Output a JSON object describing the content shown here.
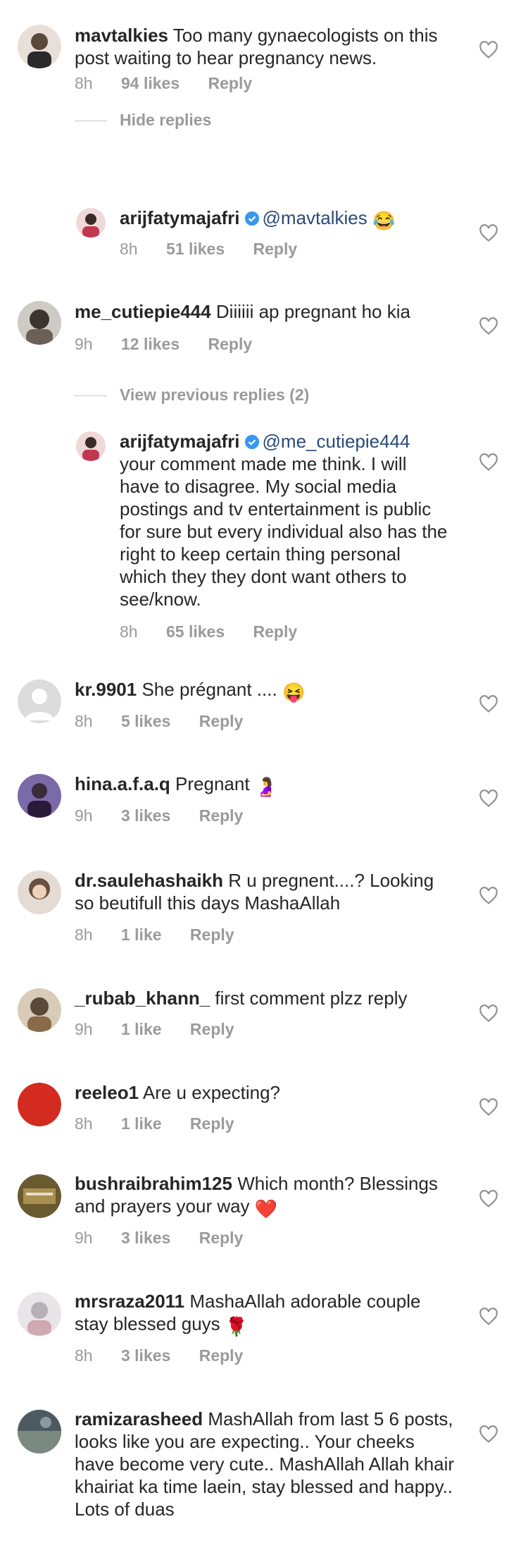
{
  "comments": [
    {
      "username": "mavtalkies",
      "text": "Too many gynaecologists on this post waiting to hear pregnancy news.",
      "time": "8h",
      "likes": "94 likes",
      "reply": "Reply",
      "avatar_color": "#5a4a3a",
      "toggle": "Hide replies",
      "replies": [
        {
          "username": "arijfatymajafri",
          "mention": "@mavtalkies",
          "text": "",
          "emoji": "😂",
          "time": "8h",
          "likes": "51 likes",
          "reply": "Reply",
          "avatar_color": "#c0384e"
        }
      ]
    },
    {
      "username": "me_cutiepie444",
      "text": "Diiiiii ap pregnant ho kia",
      "time": "9h",
      "likes": "12 likes",
      "reply": "Reply",
      "avatar_color": "#3b3530",
      "toggle": "View previous replies (2)",
      "replies": [
        {
          "username": "arijfatymajafri",
          "mention": "@me_cutiepie444",
          "text": "your comment made me think. I will have to disagree. My social media postings and tv entertainment is public for sure but every individual also has the right to keep certain thing personal which they they dont want others to see/know.",
          "time": "8h",
          "likes": "65 likes",
          "reply": "Reply",
          "avatar_color": "#c0384e"
        }
      ]
    },
    {
      "username": "kr.9901",
      "text": "She prégnant ....",
      "emoji": "😝",
      "time": "8h",
      "likes": "5 likes",
      "reply": "Reply",
      "avatar_color": "#dcdcdc"
    },
    {
      "username": "hina.a.f.a.q",
      "text": "Pregnant",
      "emoji": "🤰",
      "time": "9h",
      "likes": "3 likes",
      "reply": "Reply",
      "avatar_color": "#4a3a6a"
    },
    {
      "username": "dr.saulehashaikh",
      "text": "R u pregnent....? Looking so beutifull this days MashaAllah",
      "time": "8h",
      "likes": "1 like",
      "reply": "Reply",
      "avatar_color": "#6a5040"
    },
    {
      "username": "_rubab_khann_",
      "text": "first comment plzz reply",
      "time": "9h",
      "likes": "1 like",
      "reply": "Reply",
      "avatar_color": "#5a4838"
    },
    {
      "username": "reeleo1",
      "text": "Are u expecting?",
      "time": "8h",
      "likes": "1 like",
      "reply": "Reply",
      "avatar_color": "#d32b20"
    },
    {
      "username": "bushraibrahim125",
      "text": "Which month? Blessings and prayers your way",
      "emoji": "❤️",
      "time": "9h",
      "likes": "3 likes",
      "reply": "Reply",
      "avatar_color": "#6a5a30"
    },
    {
      "username": "mrsraza2011",
      "text": "MashaAllah adorable couple stay blessed guys",
      "emoji": "🌹",
      "time": "8h",
      "likes": "3 likes",
      "reply": "Reply",
      "avatar_color": "#b8b0b8"
    },
    {
      "username": "ramizarasheed",
      "text": "MashAllah from last 5 6 posts, looks like you are expecting.. Your cheeks have become very cute.. MashAllah Allah khair khairiat ka time laein, stay blessed and happy.. Lots of duas",
      "avatar_color": "#4a5a60"
    }
  ]
}
